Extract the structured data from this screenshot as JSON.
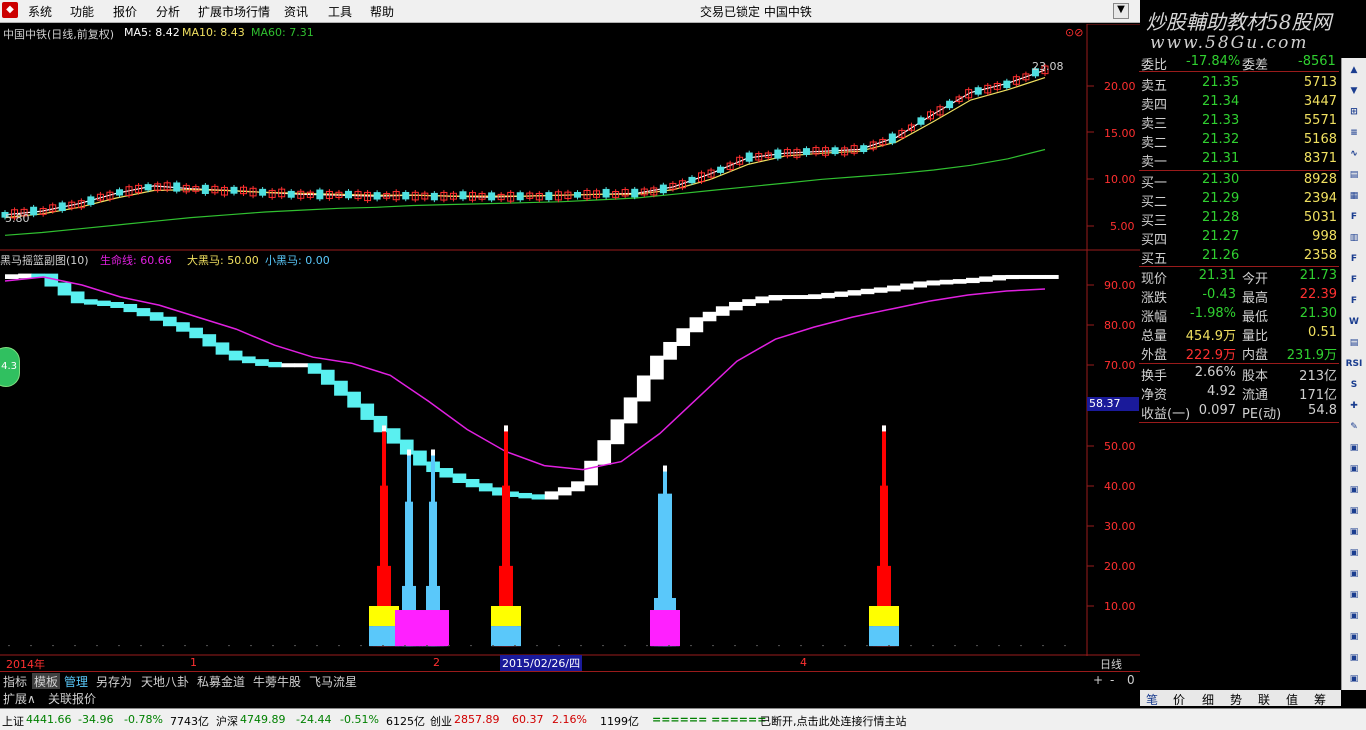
{
  "menu": {
    "logo": "◆",
    "items": [
      "系统",
      "功能",
      "报价",
      "分析",
      "扩展市场行情",
      "资讯",
      "工具",
      "帮助"
    ],
    "status_title": "交易已锁定   中国中铁",
    "minimize": "▼"
  },
  "banner": {
    "title": "炒股輔助教材58股网",
    "url": "www.58Gu.com"
  },
  "main_chart": {
    "title": "中国中铁(日线,前复权)",
    "ma5_label": "MA5: 8.42",
    "ma10_label": "MA10: 8.43",
    "ma60_label": "MA60: 7.31",
    "high_label": "23.08",
    "low_label": "5.80",
    "y_ticks": [
      "20.00",
      "15.00",
      "10.00",
      "5.00"
    ],
    "colors": {
      "ma5": "#ffffff",
      "ma10": "#f0e060",
      "ma60": "#30c030",
      "up": "#ff3030",
      "down": "#50e0e0"
    }
  },
  "sub_chart": {
    "title": "黑马摇篮副图(10)",
    "life_label": "生命线: 60.66",
    "big_label": "大黑马: 50.00",
    "small_label": "小黑马: 0.00",
    "y_ticks": [
      "90.00",
      "80.00",
      "70.00",
      "60.00",
      "50.00",
      "40.00",
      "30.00",
      "20.00",
      "10.00"
    ],
    "current_value": "58.37",
    "colors": {
      "life": "#e020e0",
      "red": "#ff0000",
      "blue": "#5ac8fa",
      "yellow": "#ffff00",
      "magenta": "#ff20ff"
    }
  },
  "time_axis": {
    "labels": [
      "2014年",
      "1",
      "2",
      "2015/02/26/四",
      "4"
    ],
    "period": "日线"
  },
  "chart_data": {
    "type": "line",
    "series": [
      {
        "name": "MA5",
        "values": [
          6.2,
          6.6,
          7.4,
          8.5,
          9.3,
          9.0,
          8.8,
          8.6,
          8.4,
          8.3,
          8.2,
          8.3,
          8.2,
          8.1,
          8.2,
          8.3,
          8.4,
          8.5,
          9.2,
          10.6,
          12.3,
          12.8,
          13.0,
          13.2,
          14.5,
          17.0,
          19.3,
          20.3,
          21.7
        ]
      },
      {
        "name": "MA10",
        "values": [
          5.9,
          6.3,
          7.0,
          8.0,
          8.8,
          8.9,
          8.8,
          8.6,
          8.5,
          8.4,
          8.3,
          8.3,
          8.2,
          8.2,
          8.2,
          8.3,
          8.4,
          8.4,
          8.9,
          10.0,
          11.6,
          12.5,
          12.8,
          13.0,
          14.0,
          16.2,
          18.5,
          19.6,
          20.9
        ]
      },
      {
        "name": "MA60",
        "values": [
          4.0,
          4.3,
          4.7,
          5.1,
          5.5,
          5.9,
          6.2,
          6.5,
          6.7,
          6.9,
          7.0,
          7.2,
          7.3,
          7.4,
          7.5,
          7.6,
          7.8,
          8.0,
          8.4,
          8.8,
          9.2,
          9.6,
          10.0,
          10.3,
          10.6,
          11.0,
          11.5,
          12.2,
          13.2
        ]
      },
      {
        "name": "生命线",
        "values": [
          91.0,
          92.0,
          90.0,
          87.0,
          85.0,
          82.0,
          79.0,
          75.0,
          72.0,
          70.5,
          67.5,
          61.0,
          54.0,
          48.5,
          45.0,
          44.0,
          46.0,
          53.0,
          62.0,
          71.0,
          76.5,
          79.5,
          82.0,
          84.0,
          86.0,
          87.5,
          88.5,
          89.0
        ]
      },
      {
        "name": "main_trend",
        "values": [
          92.0,
          92.5,
          86.0,
          85.0,
          82.0,
          78.0,
          72.0,
          70.0,
          70.0,
          62.0,
          53.0,
          45.0,
          41.0,
          38.0,
          37.0,
          40.0,
          55.0,
          71.0,
          81.0,
          85.0,
          87.0,
          87.0,
          88.0,
          89.0,
          90.5,
          91.0,
          92.0,
          92.0
        ]
      }
    ],
    "signals": [
      {
        "date_index": 0,
        "values": [
          4,
          8,
          20,
          40,
          55
        ]
      },
      {
        "date_index": 1,
        "values": [
          4,
          8,
          15,
          36,
          49
        ]
      },
      {
        "date_index": 2,
        "values": [
          4,
          8,
          15,
          36,
          49
        ]
      },
      {
        "date_index": 3,
        "values": [
          4,
          8,
          20,
          40,
          55
        ]
      },
      {
        "date_index": 4,
        "values": [
          4,
          12,
          38,
          45
        ]
      },
      {
        "date_index": 5,
        "values": [
          4,
          8,
          20,
          40,
          55
        ]
      }
    ],
    "xlabel": "",
    "ylabel": "",
    "ylim": [
      0,
      100
    ]
  },
  "quote": {
    "weibi_label": "委比",
    "weibi_value": "-17.84%",
    "weicha_label": "委差",
    "weicha_value": "-8561",
    "asks": [
      {
        "label": "卖五",
        "price": "21.35",
        "vol": "5713"
      },
      {
        "label": "卖四",
        "price": "21.34",
        "vol": "3447"
      },
      {
        "label": "卖三",
        "price": "21.33",
        "vol": "5571"
      },
      {
        "label": "卖二",
        "price": "21.32",
        "vol": "5168"
      },
      {
        "label": "卖一",
        "price": "21.31",
        "vol": "8371"
      }
    ],
    "bids": [
      {
        "label": "买一",
        "price": "21.30",
        "vol": "8928"
      },
      {
        "label": "买二",
        "price": "21.29",
        "vol": "2394"
      },
      {
        "label": "买三",
        "price": "21.28",
        "vol": "5031"
      },
      {
        "label": "买四",
        "price": "21.27",
        "vol": "998"
      },
      {
        "label": "买五",
        "price": "21.26",
        "vol": "2358"
      }
    ],
    "stats": [
      {
        "l1": "现价",
        "v1": "21.31",
        "l2": "今开",
        "v2": "21.73",
        "c1": "#30d030",
        "c2": "#30d030"
      },
      {
        "l1": "涨跌",
        "v1": "-0.43",
        "l2": "最高",
        "v2": "22.39",
        "c1": "#30d030",
        "c2": "#ff3030"
      },
      {
        "l1": "涨幅",
        "v1": "-1.98%",
        "l2": "最低",
        "v2": "21.30",
        "c1": "#30d030",
        "c2": "#30d030"
      },
      {
        "l1": "总量",
        "v1": "454.9万",
        "l2": "量比",
        "v2": "0.51",
        "c1": "#f0e060",
        "c2": "#f0e060"
      },
      {
        "l1": "外盘",
        "v1": "222.9万",
        "l2": "内盘",
        "v2": "231.9万",
        "c1": "#ff3030",
        "c2": "#30d030"
      }
    ],
    "fin": [
      {
        "l1": "换手",
        "v1": "2.66%",
        "l2": "股本",
        "v2": "213亿"
      },
      {
        "l1": "净资",
        "v1": "4.92",
        "l2": "流通",
        "v2": "171亿"
      },
      {
        "l1": "收益(一)",
        "v1": "0.097",
        "l2": "PE(动)",
        "v2": "54.8"
      }
    ]
  },
  "bottom_tabs": [
    "指标",
    "模板",
    "管理",
    "另存为",
    "天地八卦",
    "私募金道",
    "牛蒡牛股",
    "飞马流星"
  ],
  "zoom_controls": [
    "+",
    "-",
    "0"
  ],
  "ext_tabs": [
    "扩展∧",
    "关联报价"
  ],
  "mini_tabs": [
    "笔",
    "价",
    "细",
    "势",
    "联",
    "值",
    "筹"
  ],
  "status": {
    "sh_label": "上证",
    "sh_val": "4441.66",
    "sh_chg": "-34.96",
    "sh_pct": "-0.78%",
    "sh_amt": "7743亿",
    "sz_label": "沪深",
    "sz_val": "4749.89",
    "sz_chg": "-24.44",
    "sz_pct": "-0.51%",
    "sz_amt": "6125亿",
    "cy_label": "创业",
    "cy_val": "2857.89",
    "cy_chg": "60.37",
    "cy_pct": "2.16%",
    "cy_amt": "1199亿",
    "conn_bars": "====== ======",
    "message": "已断开,点击此处连接行情主站"
  },
  "left_badge": "4.3",
  "right_toolbar": [
    "▲",
    "▼",
    "⊞",
    "≡",
    "∿",
    "▤",
    "▦",
    "F",
    "▥",
    "F",
    "F",
    "F",
    "W",
    "▤",
    "RSI",
    "S",
    "✚",
    "✎",
    "▣",
    "▣",
    "▣",
    "▣",
    "▣",
    "▣",
    "▣",
    "▣",
    "▣",
    "▣",
    "▣",
    "▣"
  ]
}
